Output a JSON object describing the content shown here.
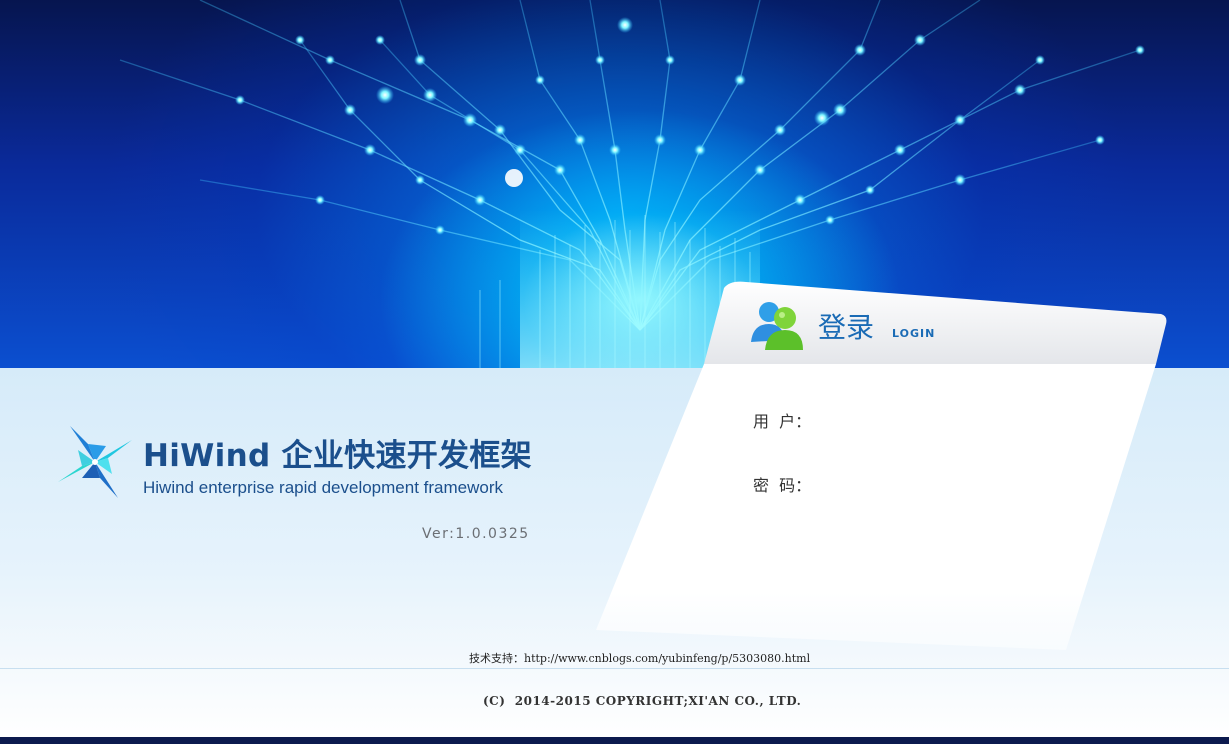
{
  "brand": {
    "title": "HiWind 企业快速开发框架",
    "subtitle": "Hiwind enterprise rapid development framework",
    "version": "Ver:1.0.0325",
    "logo_icon": "pinwheel-logo-icon"
  },
  "login": {
    "title": "登录",
    "subtitle": "LOGIN",
    "icon": "users-icon",
    "username_label": "用  户：",
    "password_label": "密  码：",
    "username_value": "",
    "password_value": ""
  },
  "footer": {
    "support_label": "技术支持：",
    "support_link": "http://www.cnblogs.com/yubinfeng/p/5303080.html",
    "copyright": "(C)  2014-2015 COPYRIGHT;XI'AN CO., LTD."
  },
  "colors": {
    "brand_blue": "#1b4f8c",
    "login_blue": "#1a6bb5",
    "banner_dark": "#06154f",
    "banner_glow": "#00d2ff"
  }
}
